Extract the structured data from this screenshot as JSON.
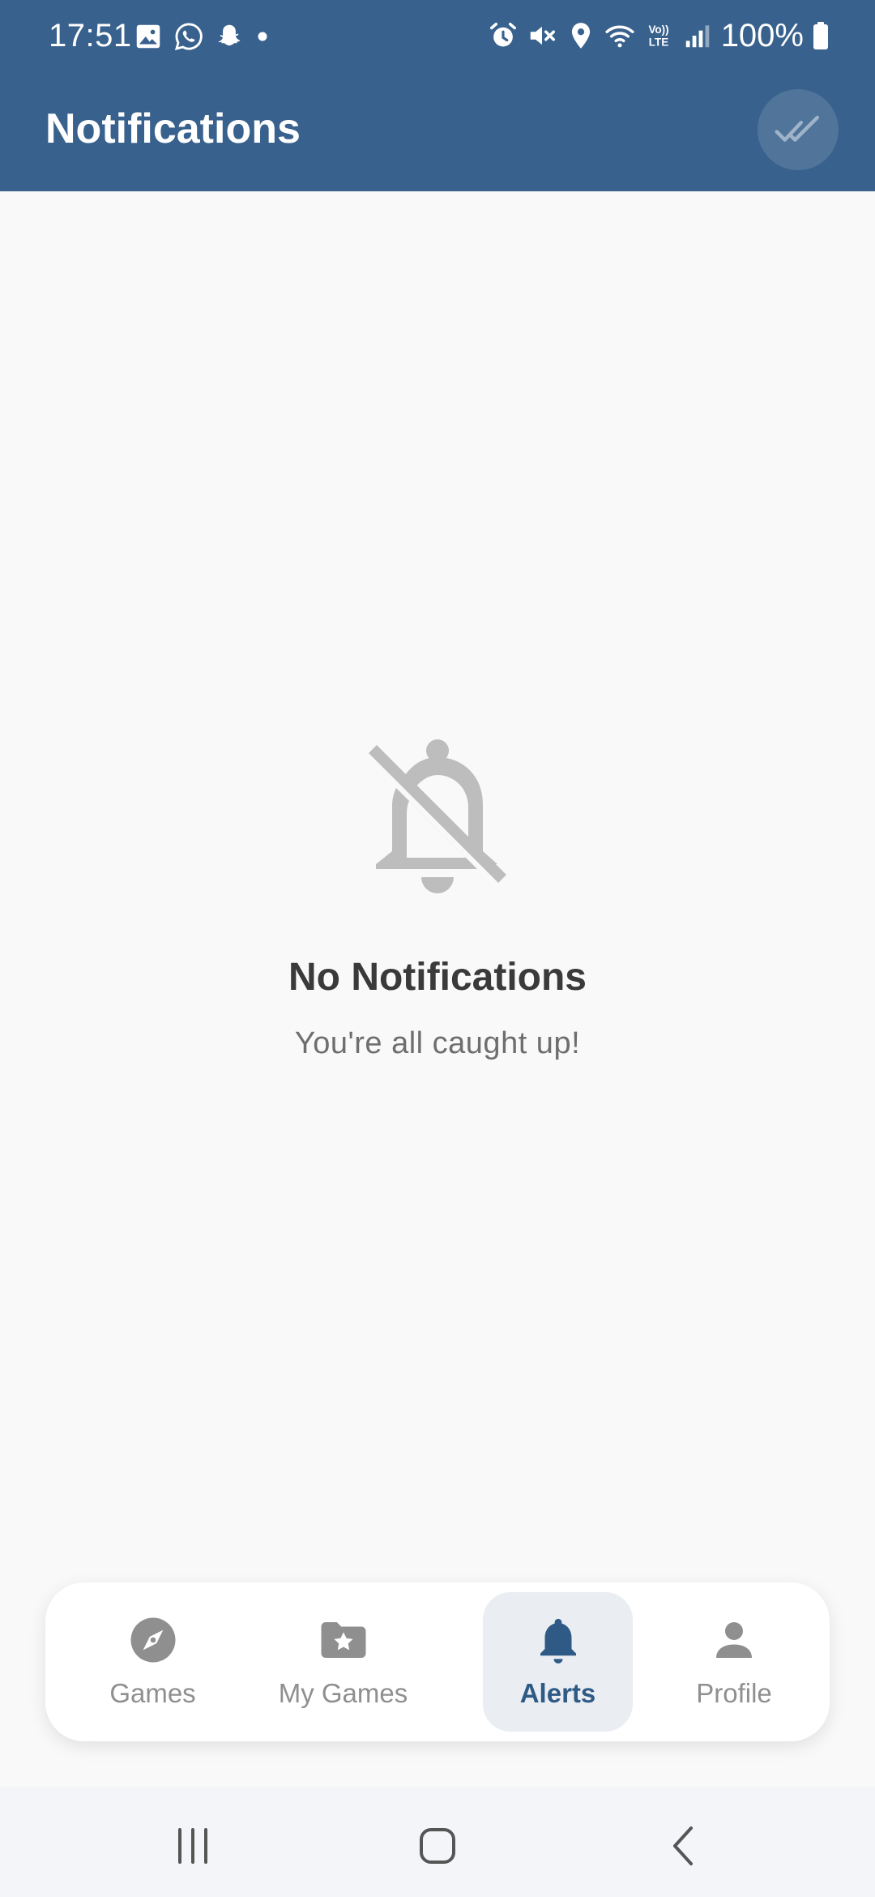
{
  "status_bar": {
    "time": "17:51",
    "battery": "100%",
    "left_icons": [
      "gallery-icon",
      "whatsapp-icon",
      "snapchat-icon",
      "dot-icon"
    ],
    "right_icons": [
      "alarm-icon",
      "mute-icon",
      "location-icon",
      "wifi-icon",
      "volte-icon",
      "signal-icon",
      "battery-icon"
    ]
  },
  "header": {
    "title": "Notifications",
    "action_icon": "double-check-icon"
  },
  "empty_state": {
    "icon": "bell-off-icon",
    "title": "No Notifications",
    "subtitle": "You're all caught up!"
  },
  "bottom_nav": {
    "items": [
      {
        "label": "Games",
        "icon": "compass-icon",
        "active": false
      },
      {
        "label": "My Games",
        "icon": "star-folder-icon",
        "active": false
      },
      {
        "label": "Alerts",
        "icon": "bell-icon",
        "active": true
      },
      {
        "label": "Profile",
        "icon": "person-icon",
        "active": false
      }
    ]
  },
  "system_nav": {
    "buttons": [
      "recents-icon",
      "home-icon",
      "back-icon"
    ]
  },
  "colors": {
    "header_bg": "#38618d",
    "page_bg": "#f9f9f9",
    "active_nav": "#2f5a85",
    "inactive_nav": "#8f8f8f",
    "empty_icon": "#bdbdbd"
  }
}
